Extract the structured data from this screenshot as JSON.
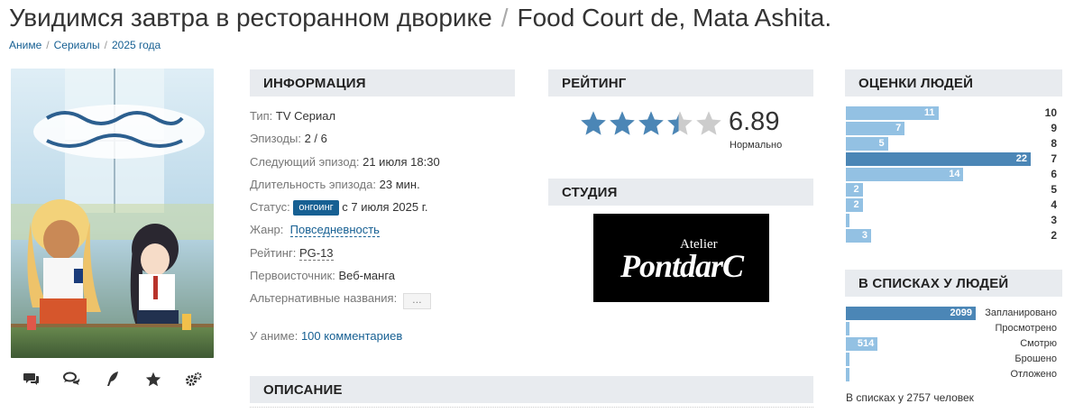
{
  "page": {
    "title_ru": "Увидимся завтра в ресторанном дворике",
    "title_separator": "/",
    "title_en": "Food Court de, Mata Ashita."
  },
  "breadcrumbs": [
    "Аниме",
    "Сериалы",
    "2025 года"
  ],
  "breadcrumb_separator": "/",
  "poster": {
    "actions": [
      "comments-icon",
      "discussion-icon",
      "review-icon",
      "favorite-star-icon",
      "settings-icon"
    ]
  },
  "info": {
    "heading": "ИНФОРМАЦИЯ",
    "type_label": "Тип:",
    "type_value": "TV Сериал",
    "episodes_label": "Эпизоды:",
    "episodes_value": "2 / 6",
    "next_label": "Следующий эпизод:",
    "next_value": "21 июля 18:30",
    "duration_label": "Длительность эпизода:",
    "duration_value": "23 мин.",
    "status_label": "Статус:",
    "status_badge": "онгоинг",
    "status_since": "с 7 июля 2025 г.",
    "genre_label": "Жанр:",
    "genre_value": "Повседневность",
    "age_label": "Рейтинг:",
    "age_value": "PG-13",
    "source_label": "Первоисточник:",
    "source_value": "Веб-манга",
    "alt_label": "Альтернативные названия:",
    "alt_button": "…",
    "comments_label": "У аниме:",
    "comments_link": "100 комментариев"
  },
  "rating": {
    "heading": "РЕЙТИНГ",
    "score": "6.89",
    "score_word": "Нормально",
    "stars_filled": 3.45,
    "stars_total": 5,
    "star_color": "#4b86b6",
    "star_empty_color": "#cccccc"
  },
  "studio": {
    "heading": "СТУДИЯ",
    "logo_small": "Atelier",
    "logo_big": "PontdarC"
  },
  "people_scores": {
    "heading": "ОЦЕНКИ ЛЮДЕЙ",
    "rows": [
      {
        "score": "10",
        "count": "11",
        "value": 11
      },
      {
        "score": "9",
        "count": "7",
        "value": 7
      },
      {
        "score": "8",
        "count": "5",
        "value": 5
      },
      {
        "score": "7",
        "count": "22",
        "value": 22
      },
      {
        "score": "6",
        "count": "14",
        "value": 14
      },
      {
        "score": "5",
        "count": "2",
        "value": 2
      },
      {
        "score": "4",
        "count": "2",
        "value": 2
      },
      {
        "score": "3",
        "count": "",
        "value": 0.4
      },
      {
        "score": "2",
        "count": "3",
        "value": 3
      }
    ],
    "max": 22
  },
  "in_lists": {
    "heading": "В СПИСКАХ У ЛЮДЕЙ",
    "rows": [
      {
        "label": "Запланировано",
        "count": "2099",
        "value": 2099
      },
      {
        "label": "Просмотрено",
        "count": "",
        "value": 0
      },
      {
        "label": "Смотрю",
        "count": "514",
        "value": 514
      },
      {
        "label": "Брошено",
        "count": "",
        "value": 30
      },
      {
        "label": "Отложено",
        "count": "",
        "value": 30
      }
    ],
    "max": 2099,
    "footer": "В списках у 2757 человек"
  },
  "description": {
    "heading": "ОПИСАНИЕ"
  },
  "colors": {
    "accent": "#176093",
    "bar_top": "#4b86b6",
    "bar": "#93c1e3",
    "heading_bg": "#e8ebef"
  }
}
